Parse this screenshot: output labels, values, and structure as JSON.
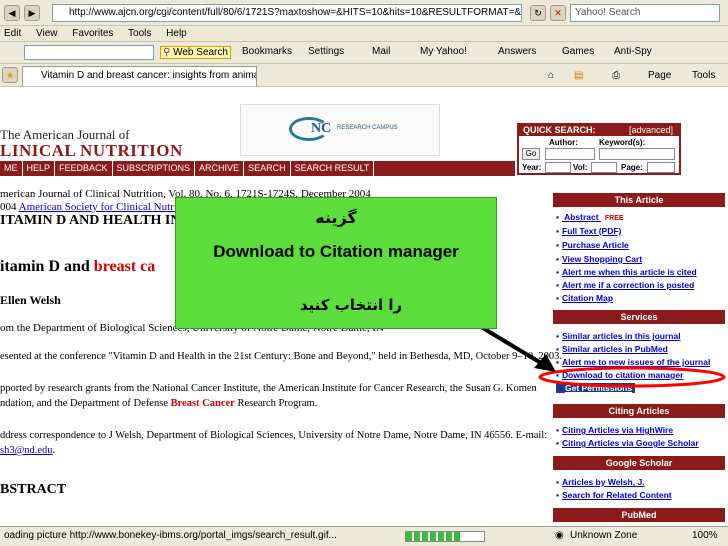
{
  "browser": {
    "address": "http://www.ajcn.org/cgi/content/full/80/6/1721S?maxtoshow=&HITS=10&hits=10&RESULTFORMAT=&title=breast+cance",
    "yahoo_search_placeholder": "Yahoo! Search",
    "menu": [
      "Edit",
      "View",
      "Favorites",
      "Tools",
      "Help"
    ],
    "toolbar": [
      "Web Search",
      "Bookmarks",
      "Settings",
      "Mail",
      "My Yahoo!",
      "Answers",
      "Games",
      "Anti-Spy"
    ],
    "toolbar_right": [
      "Page",
      "Tools"
    ],
    "tab_title": "Vitamin D and breast cancer: insights from animal mod...",
    "status_text": "oading picture http://www.bonekey-ibms.org/portal_imgs/search_result.gif...",
    "status_zone": "Unknown Zone",
    "status_zoom": "100%"
  },
  "site": {
    "journal_line1": "The American Journal of",
    "journal_line2": "LINICAL NUTRITION",
    "logo_text": "NC",
    "logo_sub": "RESEARCH CAMPUS",
    "nav": [
      "ME",
      "HELP",
      "FEEDBACK",
      "SUBSCRIPTIONS",
      "ARCHIVE",
      "SEARCH",
      "SEARCH RESULT"
    ],
    "quick_search": {
      "title": "QUICK SEARCH:",
      "advanced": "[advanced]",
      "author_label": "Author:",
      "keyword_label": "Keyword(s):",
      "go_label": "Go",
      "year_label": "Year:",
      "vol_label": "Vol:",
      "page_label": "Page:"
    }
  },
  "article": {
    "citation": "merican Journal of Clinical Nutrition, Vol. 80, No. 6, 1721S-1724S, December 2004",
    "copyright_year": "004",
    "copyright_link": "American Society for Clinical Nutrition",
    "title_partial": "ITAMIN D AND HEALTH IN",
    "subtitle_start": "itamin D and ",
    "subtitle_red": "breast ca",
    "author": "Ellen Welsh",
    "affil": "om the Department of Biological Sciences, University of Notre Dame, Notre Dame, IN",
    "presented": "esented at the conference \"Vitamin D and Health in the 21st Century: Bone and Beyond,\" held in Bethesda, MD, October 9–10, 2003.",
    "support1": "pported by research grants from the National Cancer Institute, the American Institute for Cancer Research, the Susan G. Komen",
    "support2_a": "ndation, and the Department of Defense ",
    "support2_red": "Breast Cancer",
    "support2_b": " Research Program.",
    "corr": "ddress correspondence to J Welsh, Department of Biological Sciences, University of Notre Dame, Notre Dame, IN 46556. E-mail:",
    "email": "sh3@nd.edu",
    "abstract": "BSTRACT"
  },
  "sidebar": {
    "this_article": "This Article",
    "links1": [
      "Abstract",
      "Full Text (PDF)",
      "Purchase Article",
      "View Shopping Cart",
      "Alert me when this article is cited",
      "Alert me if a correction is posted",
      "Citation Map"
    ],
    "free_badge": "FREE",
    "services": "Services",
    "links2": [
      "Similar articles in this journal",
      "Similar articles in PubMed",
      "Alert me to new issues of the journal",
      "Download to citation manager",
      "Get Permissions"
    ],
    "citing": "Citing Articles",
    "links3": [
      "Citing Articles via HighWire",
      "Citing Articles via Google Scholar"
    ],
    "scholar": "Google Scholar",
    "links4": [
      "Articles by Welsh, J.",
      "Search for Related Content"
    ],
    "pubmed": "PubMed"
  },
  "overlay": {
    "line1": "گزینه",
    "line2": "Download to Citation manager",
    "line3": "را انتخاب کنید"
  },
  "colors": {
    "brand": "#8b1a1a",
    "overlay_green": "#5cdd3c",
    "highlight": "#ff0000",
    "link": "#0000cc"
  }
}
